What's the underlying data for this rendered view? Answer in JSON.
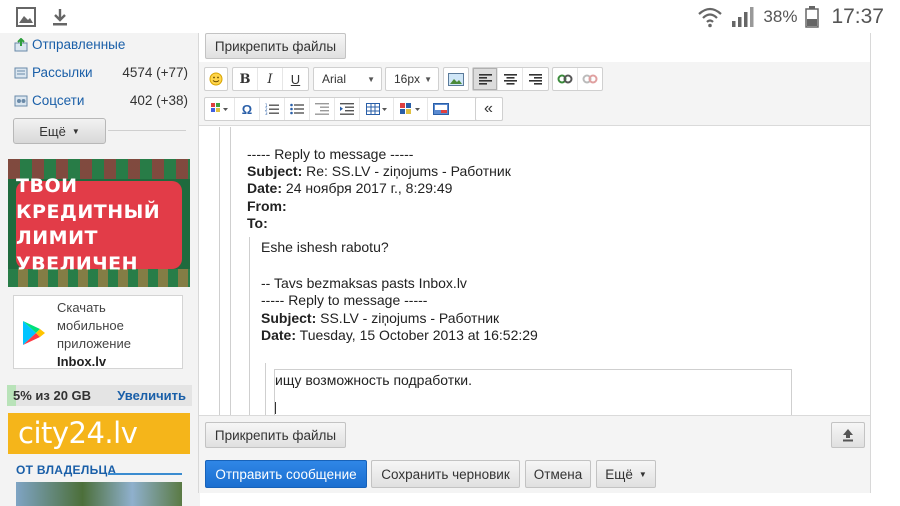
{
  "statusbar": {
    "battery_pct": "38%",
    "time": "17:37"
  },
  "sidebar": {
    "folders": [
      {
        "name": "Отправленные",
        "count": ""
      },
      {
        "name": "Рассылки",
        "count": "4574 (+77)"
      },
      {
        "name": "Соцсети",
        "count": "402 (+38)"
      }
    ],
    "more_label": "Ещё",
    "ad_line1": "ТВОИ КРЕДИТНЫЙ",
    "ad_line2": "ЛИМИТ УВЕЛИЧЕН",
    "app_line1": "Скачать",
    "app_line2": "мобильное",
    "app_line3": "приложение",
    "app_line4": "Inbox.lv",
    "quota_text": "5% из 20 GB",
    "quota_fraction": 0.05,
    "quota_link": "Увеличить",
    "city24_text": "city24.lv",
    "owner_text": "ОТ ВЛАДЕЛЬЦА"
  },
  "compose": {
    "attach_label": "Прикрепить файлы",
    "font_name": "Arial",
    "font_size": "16px",
    "message": {
      "reply_header": "----- Reply to message -----",
      "subject_label": "Subject:",
      "subject_value": "Re: SS.LV - ziņojums - Работник",
      "date_label": "Date:",
      "date_value": "24 ноября 2017 г., 8:29:49",
      "from_label": "From:",
      "to_label": "To:",
      "q2_text": "Eshe ishesh rabotu?",
      "q2_sig": "-- Tavs bezmaksas pasts Inbox.lv",
      "q2_reply_header": "----- Reply to message -----",
      "q2_subject_value": "SS.LV - ziņojums - Работник",
      "q2_date_value": "Tuesday, 15 October 2013 at 16:52:29",
      "q3_text": "ищу возможность подработки."
    },
    "send_label": "Отправить сообщение",
    "draft_label": "Сохранить черновик",
    "cancel_label": "Отмена",
    "more_label": "Ещё"
  }
}
